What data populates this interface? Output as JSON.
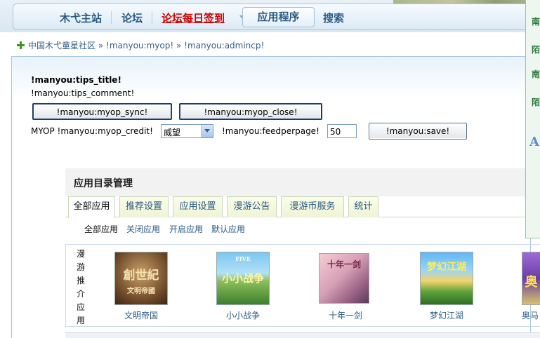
{
  "nav": {
    "items": [
      "木弋主站",
      "论坛",
      "论坛每日签到",
      "应用程序",
      "搜索"
    ]
  },
  "breadcrumb": {
    "items": [
      "中国木弋童星社区",
      "!manyou:myop!",
      "!manyou:admincp!"
    ],
    "separator": "»"
  },
  "settings": {
    "tips_title": "!manyou:tips_title!",
    "tips_comment": "!manyou:tips_comment!",
    "sync_button": "!manyou:myop_sync!",
    "close_button": "!manyou:myop_close!",
    "credit_label": "MYOP !manyou:myop_credit!",
    "credit_value": "威望",
    "feedperpage_label": "!manyou:feedperpage!",
    "feedperpage_value": "50",
    "save_button": "!manyou:save!"
  },
  "panel": {
    "title": "应用目录管理",
    "tabs": [
      "全部应用",
      "推荐设置",
      "应用设置",
      "漫游公告",
      "漫游币服务",
      "统计"
    ],
    "active_tab": "全部应用",
    "subnav": [
      "全部应用",
      "关闭应用",
      "开启应用",
      "默认应用"
    ],
    "recommend_label": [
      "漫",
      "游",
      "推",
      "介",
      "应",
      "用"
    ],
    "apps": [
      {
        "name": "文明帝国",
        "thumb_text": "創世紀",
        "thumb_sub": "文明帝國"
      },
      {
        "name": "小小战争",
        "thumb_text": "小小战争",
        "thumb_sub": "FIVE"
      },
      {
        "name": "十年一剑",
        "thumb_text": "十年一剑",
        "thumb_sub": ""
      },
      {
        "name": "梦幻江湖",
        "thumb_text": "梦幻江湖",
        "thumb_sub": ""
      },
      {
        "name": "奥马",
        "thumb_text": "奥",
        "thumb_sub": ""
      }
    ]
  },
  "right_panel": {
    "items": [
      "南",
      "陌",
      "南",
      "陌"
    ],
    "letter": "A"
  },
  "colors": {
    "link": "#2a5a85",
    "red_nav": "#cc0000",
    "plus_icon": "#3a9a1c"
  }
}
